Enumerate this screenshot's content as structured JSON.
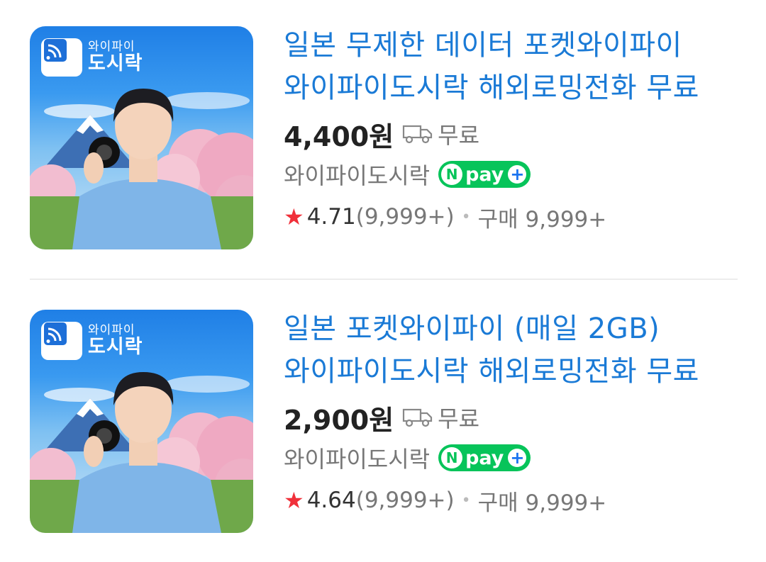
{
  "products": [
    {
      "thumb_logo_line1": "와이파이",
      "thumb_logo_line2": "도시락",
      "title": "일본 무제한 데이터 포켓와이파이 와이파이도시락 해외로밍전화 무료",
      "price": "4,400원",
      "shipping": "무료",
      "seller": "와이파이도시락",
      "npay": {
        "n": "N",
        "pay": "pay",
        "plus": "+"
      },
      "star_icon": "star-icon",
      "rating": "4.71",
      "review_count": "(9,999+)",
      "separator": "•",
      "purchase": "구매 9,999+"
    },
    {
      "thumb_logo_line1": "와이파이",
      "thumb_logo_line2": "도시락",
      "title": "일본 포켓와이파이 (매일 2GB) 와이파이도시락 해외로밍전화 무료",
      "price": "2,900원",
      "shipping": "무료",
      "seller": "와이파이도시락",
      "npay": {
        "n": "N",
        "pay": "pay",
        "plus": "+"
      },
      "star_icon": "star-icon",
      "rating": "4.64",
      "review_count": "(9,999+)",
      "separator": "•",
      "purchase": "구매 9,999+"
    }
  ],
  "colors": {
    "title": "#1a7ad6",
    "npay_green": "#07c45a",
    "star_red": "#f0303a"
  }
}
